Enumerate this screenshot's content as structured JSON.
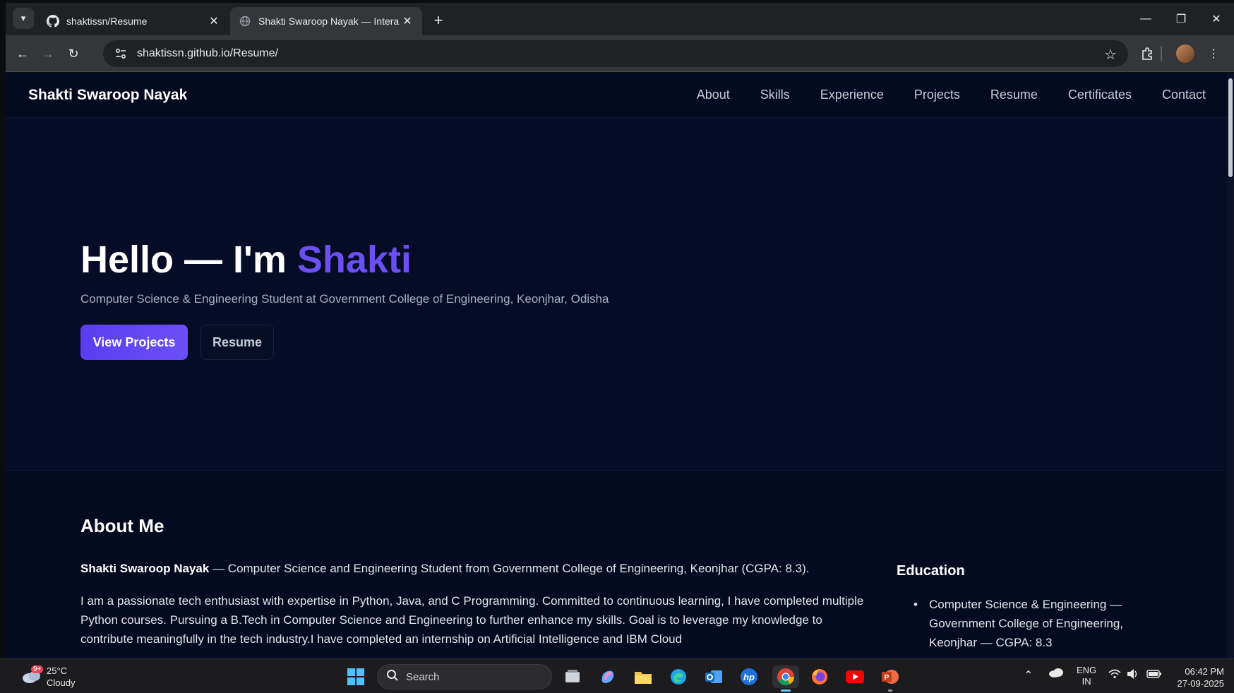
{
  "browser": {
    "tabs": [
      {
        "title": "shaktissn/Resume",
        "active": false
      },
      {
        "title": "Shakti Swaroop Nayak — Intera",
        "active": true
      }
    ],
    "url": "shaktissn.github.io/Resume/"
  },
  "site": {
    "brand": "Shakti Swaroop Nayak",
    "nav": [
      "About",
      "Skills",
      "Experience",
      "Projects",
      "Resume",
      "Certificates",
      "Contact"
    ],
    "hero": {
      "greeting": "Hello — I'm",
      "name": "Shakti",
      "subtitle": "Computer Science & Engineering Student at Government College of Engineering, Keonjhar, Odisha",
      "primary_button": "View Projects",
      "secondary_button": "Resume"
    },
    "about": {
      "heading": "About Me",
      "intro_name": "Shakti Swaroop Nayak",
      "intro_rest": " — Computer Science and Engineering Student from Government College of Engineering, Keonjhar (CGPA: 8.3).",
      "bio": "I am a passionate tech enthusiast with expertise in Python, Java, and C Programming. Committed to continuous learning, I have completed multiple Python courses. Pursuing a B.Tech in Computer Science and Engineering to further enhance my skills. Goal is to leverage my knowledge to contribute meaningfully in the tech industry.I have completed an internship on Artificial Intelligence and IBM Cloud",
      "education_heading": "Education",
      "education": [
        "Computer Science & Engineering — Government College of Engineering, Keonjhar — CGPA: 8.3"
      ]
    }
  },
  "taskbar": {
    "weather_temp": "25°C",
    "weather_desc": "Cloudy",
    "weather_badge": "9+",
    "search_placeholder": "Search",
    "language": "ENG",
    "region": "IN",
    "time": "06:42 PM",
    "date": "27-09-2025"
  },
  "colors": {
    "accent": "#6b4ff0",
    "page_bg": "#050b22",
    "chrome_bg": "#202124"
  }
}
